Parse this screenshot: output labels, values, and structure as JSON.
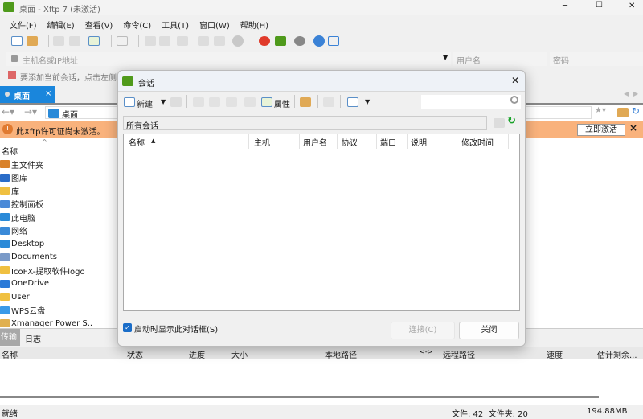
{
  "window": {
    "title": "桌面 - Xftp 7 (未激活)",
    "minimize": "─",
    "maximize": "☐",
    "close": "✕"
  },
  "menu": [
    "文件(F)",
    "编辑(E)",
    "查看(V)",
    "命令(C)",
    "工具(T)",
    "窗口(W)",
    "帮助(H)"
  ],
  "address": {
    "host_placeholder": "主机名或IP地址",
    "user_placeholder": "用户名",
    "password_placeholder": "密码"
  },
  "hint": "要添加当前会话，点击左侧的",
  "tab": {
    "label": "桌面",
    "close": "×"
  },
  "nav": {
    "path": "桌面"
  },
  "banner": {
    "text": "此Xftp许可证尚未激活。",
    "activate": "立即激活",
    "close": "×",
    "color": "#f9b27c"
  },
  "file_list": {
    "header": "名称",
    "items": [
      "主文件夹",
      "图库",
      "库",
      "控制面板",
      "此电脑",
      "网络",
      "Desktop",
      "Documents",
      "IcoFX-提取软件logo",
      "OneDrive",
      "User",
      "WPS云盘",
      "Xmanager Power S..."
    ]
  },
  "bottom_tabs": [
    "传输",
    "日志"
  ],
  "transfer_columns": [
    "名称",
    "状态",
    "进度",
    "大小",
    "本地路径",
    "<->",
    "远程路径",
    "速度",
    "估计剩余..."
  ],
  "status": {
    "ready": "就绪",
    "counts": "文件: 42  文件夹: 20",
    "size": "194.88MB"
  },
  "dialog": {
    "title": "会话",
    "close": "✕",
    "toolbar": {
      "new": "新建",
      "properties": "属性"
    },
    "search_placeholder": "",
    "folder": "所有会话",
    "columns": [
      "名称",
      "主机",
      "用户名",
      "协议",
      "端口",
      "说明",
      "修改时间"
    ],
    "checkbox": "启动时显示此对话框(S)",
    "connect": "连接(C)",
    "close_btn": "关闭"
  }
}
